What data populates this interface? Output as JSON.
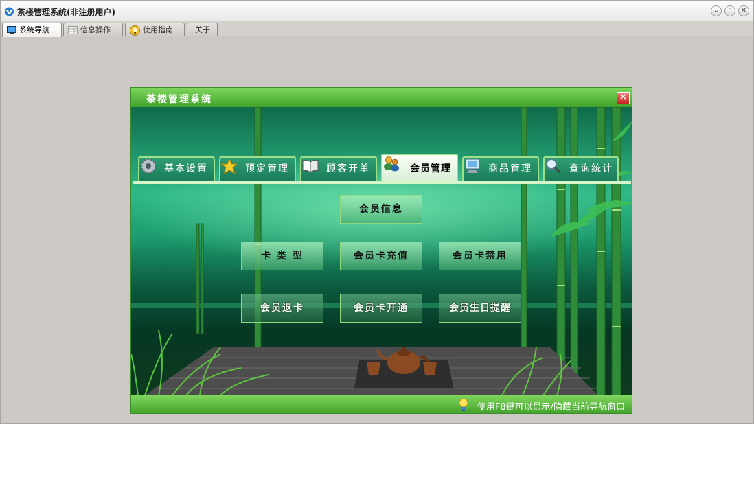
{
  "window": {
    "title": "茶楼管理系统(非注册用户)",
    "controls": [
      "minimize",
      "restore",
      "close"
    ]
  },
  "top_tabs": [
    {
      "label": "系统导航",
      "icon": "monitor-icon",
      "active": true
    },
    {
      "label": "信息操作",
      "icon": "grid-icon",
      "active": false
    },
    {
      "label": "使用指南",
      "icon": "lightbulb-icon",
      "active": false
    },
    {
      "label": "关于",
      "icon": "",
      "active": false
    }
  ],
  "nav_window": {
    "title": "茶楼管理系统",
    "close_symbol": "✕"
  },
  "module_tabs": [
    {
      "label": "基本设置",
      "icon": "gear-icon",
      "active": false
    },
    {
      "label": "预定管理",
      "icon": "star-icon",
      "active": false
    },
    {
      "label": "顾客开单",
      "icon": "book-icon",
      "active": false
    },
    {
      "label": "会员管理",
      "icon": "members-icon",
      "active": true
    },
    {
      "label": "商品管理",
      "icon": "computer-icon",
      "active": false
    },
    {
      "label": "查询统计",
      "icon": "magnifier-icon",
      "active": false
    }
  ],
  "function_buttons": {
    "member_info": "会员信息",
    "card_type": "卡 类 型",
    "card_recharge": "会员卡充值",
    "card_disable": "会员卡禁用",
    "member_card_return": "会员退卡",
    "card_activate": "会员卡开通",
    "birthday_reminder": "会员生日提醒"
  },
  "status_bar": {
    "hint": "使用F8键可以显示/隐藏当前导航窗口",
    "hint_icon": "lightbulb-icon"
  },
  "colors": {
    "title_green": "#41a22a",
    "scene_green": "#2fb987",
    "tab_border": "#9fe08a",
    "close_red": "#c92222"
  }
}
